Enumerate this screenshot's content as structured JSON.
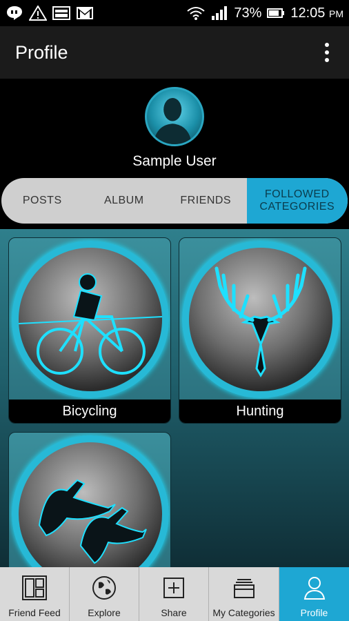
{
  "status_bar": {
    "battery": "73%",
    "time": "12:05",
    "ampm": "PM",
    "icons": [
      "hangouts-icon",
      "warning-icon",
      "image-icon",
      "gmail-icon",
      "wifi-icon",
      "signal-icon",
      "battery-icon"
    ]
  },
  "app_bar": {
    "title": "Profile",
    "menu_icon": "overflow-menu-icon"
  },
  "profile": {
    "name": "Sample User"
  },
  "tabs": [
    {
      "label": "POSTS",
      "active": false
    },
    {
      "label": "ALBUM",
      "active": false
    },
    {
      "label": "FRIENDS",
      "active": false
    },
    {
      "label": "FOLLOWED CATEGORIES",
      "active": true
    }
  ],
  "categories": [
    {
      "label": "Bicycling",
      "icon": "bicycle-icon"
    },
    {
      "label": "Hunting",
      "icon": "deer-skull-icon"
    },
    {
      "label": "",
      "icon": "ducks-icon"
    }
  ],
  "bottom_nav": [
    {
      "label": "Friend Feed",
      "icon": "feed-icon",
      "active": false
    },
    {
      "label": "Explore",
      "icon": "globe-icon",
      "active": false
    },
    {
      "label": "Share",
      "icon": "plus-icon",
      "active": false
    },
    {
      "label": "My Categories",
      "icon": "stack-icon",
      "active": false
    },
    {
      "label": "Profile",
      "icon": "person-icon",
      "active": true
    }
  ],
  "colors": {
    "accent": "#1ea7d3",
    "ring": "#27b9d6"
  }
}
